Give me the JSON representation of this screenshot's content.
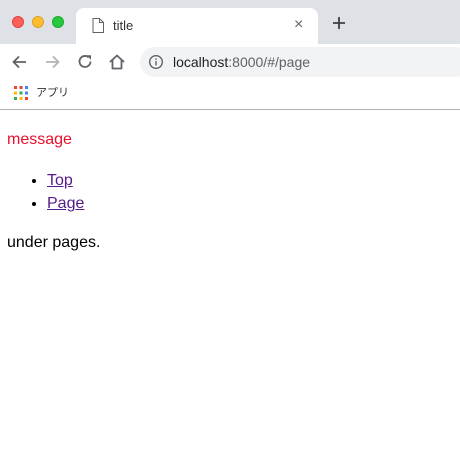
{
  "browser": {
    "tab": {
      "title": "title",
      "close_label": "×"
    },
    "new_tab_label": "+",
    "address": {
      "host": "localhost",
      "rest": ":8000/#/page"
    },
    "bookmarks": {
      "apps_label": "アプリ"
    }
  },
  "page": {
    "message": "message",
    "links": [
      {
        "label": "Top"
      },
      {
        "label": "Page"
      }
    ],
    "footer_text": "under pages."
  },
  "colors": {
    "message": "#e8112d",
    "visited_link": "#551a8b",
    "tabstrip_bg": "#dee1e6"
  },
  "icons": [
    "document-icon",
    "close-icon",
    "plus-icon",
    "back-arrow-icon",
    "forward-arrow-icon",
    "reload-icon",
    "home-icon",
    "info-icon",
    "apps-grid-icon"
  ]
}
